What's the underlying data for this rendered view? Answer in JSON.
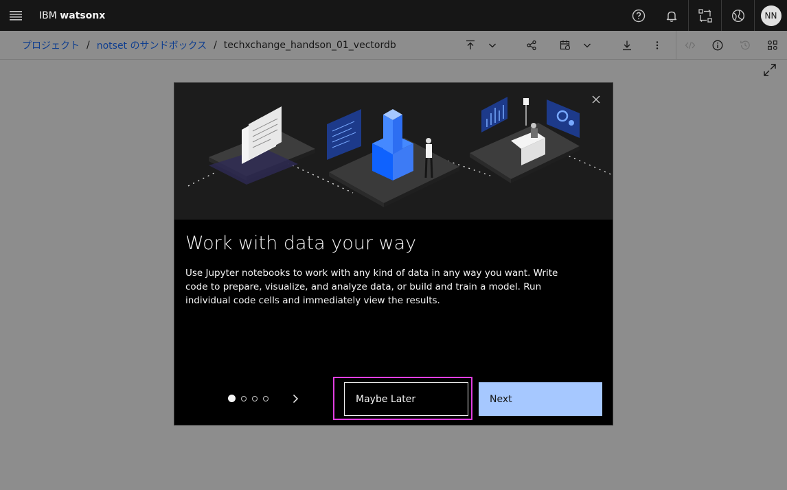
{
  "header": {
    "brand_prefix": "IBM",
    "brand_product": "watsonx",
    "avatar_initials": "NN"
  },
  "breadcrumb": {
    "items": [
      "プロジェクト",
      "notset のサンドボックス"
    ],
    "separator": "/",
    "current": "techxchange_handson_01_vectordb"
  },
  "modal": {
    "title": "Work with data your way",
    "body": "Use Jupyter notebooks to work with any kind of data in any way you want. Write code to prepare, visualize, and analyze data, or build and train a model. Run individual code cells and immediately view the results.",
    "maybe_later_label": "Maybe Later",
    "next_label": "Next",
    "pages": 4,
    "current_page": 1
  },
  "colors": {
    "topbar": "#161616",
    "page_overlay": "#8d8d8d",
    "link": "#0f3e8f",
    "primary_button": "#a6c8ff",
    "focus_highlight": "#e23fe2"
  },
  "icons": [
    "menu-icon",
    "help-icon",
    "notification-icon",
    "switcher-icon",
    "globe-icon",
    "upload-icon",
    "share-icon",
    "schedule-icon",
    "download-icon",
    "overflow-icon",
    "code-icon",
    "info-icon",
    "history-icon",
    "apps-icon",
    "maximize-icon",
    "close-icon",
    "chevron-right-icon"
  ]
}
